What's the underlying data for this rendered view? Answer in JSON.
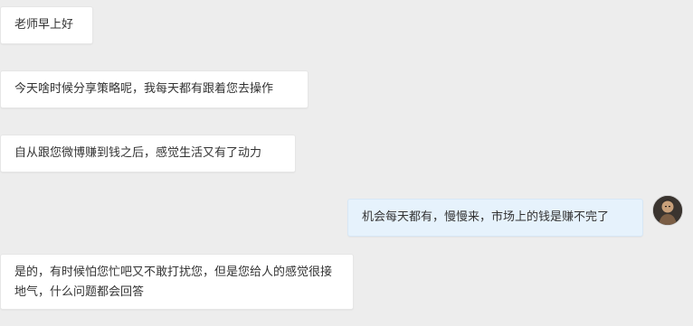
{
  "messages": [
    {
      "side": "left",
      "text": "老师早上好"
    },
    {
      "side": "left",
      "text": "今天啥时候分享策略呢，我每天都有跟着您去操作"
    },
    {
      "side": "left",
      "text": "自从跟您微博赚到钱之后，感觉生活又有了动力"
    },
    {
      "side": "right",
      "text": "机会每天都有，慢慢来，市场上的钱是赚不完了"
    },
    {
      "side": "left",
      "text": "是的，有时候怕您忙吧又不敢打扰您，但是您给人的感觉很接地气，什么问题都会回答"
    }
  ],
  "colors": {
    "background": "#ededed",
    "incoming_bubble": "#ffffff",
    "outgoing_bubble": "#e6f2fc",
    "text": "#333333"
  },
  "avatar_icon": "user-avatar-icon"
}
